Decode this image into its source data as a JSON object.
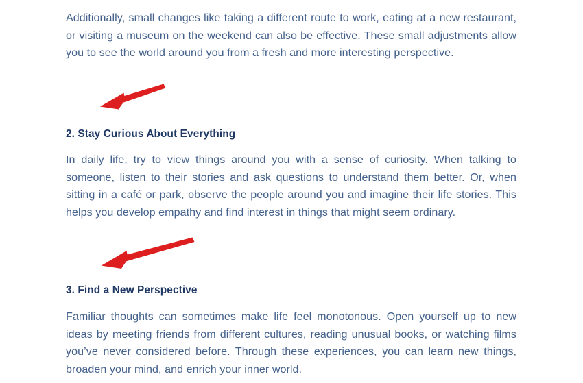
{
  "document": {
    "paragraphs": {
      "p1": "Additionally, small changes like taking a different route to work, eating at a new restaurant, or visiting a museum on the weekend can also be effective. These small adjustments allow you to see the world around you from a fresh and more interesting perspective.",
      "p2": "In daily life, try to view things around you with a sense of curiosity. When talking to someone, listen to their stories and ask questions to understand them better. Or, when sitting in a café or park, observe the people around you and imagine their life stories. This helps you develop empathy and find interest in things that might seem ordinary.",
      "p3": "Familiar thoughts can sometimes make life feel monotonous. Open yourself up to new ideas by meeting friends from different cultures, reading unusual books, or watching films you’ve never considered before. Through these experiences, you can learn new things, broaden your mind, and enrich your inner world."
    },
    "headings": {
      "h2": "2. Stay Curious About Everything",
      "h3": "3. Find a New Perspective"
    },
    "annotations": [
      {
        "name": "red-arrow-pointing-to-heading-2",
        "color": "#dd1f1f"
      },
      {
        "name": "red-arrow-pointing-to-heading-3",
        "color": "#dd1f1f"
      }
    ],
    "colors": {
      "body_text": "#44618b",
      "heading_text": "#1f3864",
      "annotation_red": "#dd1f1f",
      "page_background": "#ffffff"
    }
  }
}
